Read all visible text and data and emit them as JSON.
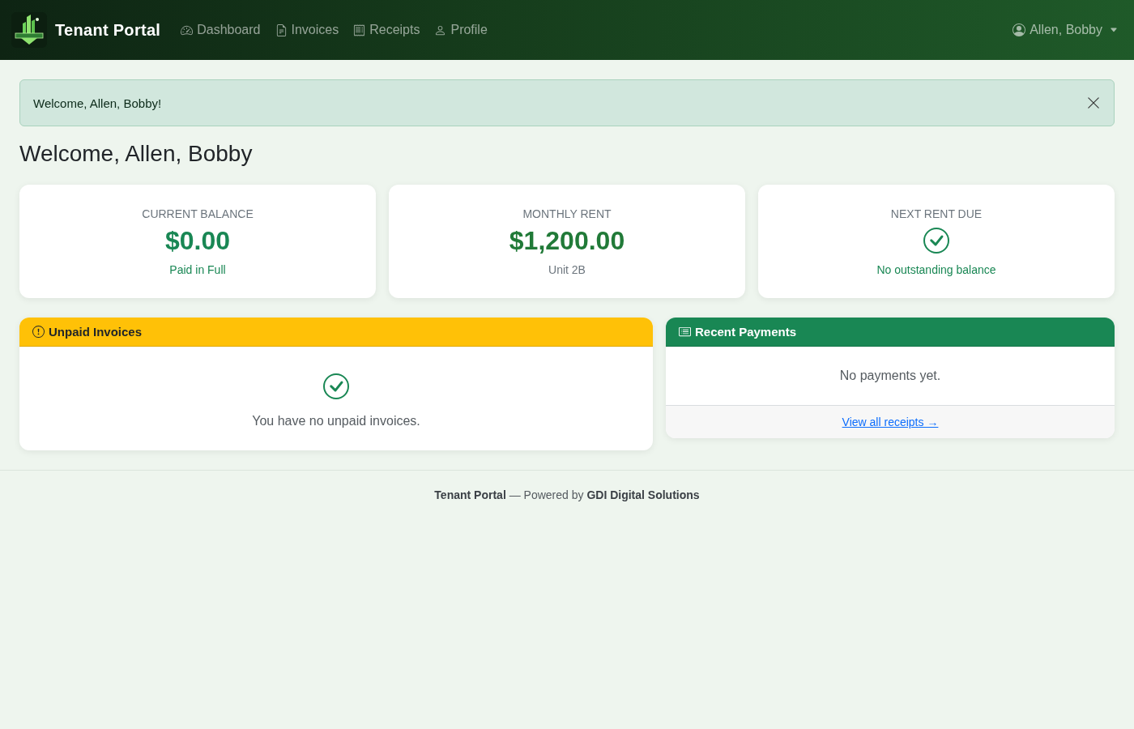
{
  "navbar": {
    "brand": "Tenant Portal",
    "links": [
      {
        "label": "Dashboard",
        "selected": false
      },
      {
        "label": "Invoices",
        "selected": false
      },
      {
        "label": "Receipts",
        "selected": false
      },
      {
        "label": "Profile",
        "selected": false
      }
    ],
    "user": {
      "name": "Allen, Bobby"
    }
  },
  "alert": {
    "message": "Welcome, Allen, Bobby!"
  },
  "heading": "Welcome, Allen, Bobby",
  "stat_cards": [
    {
      "kind": "amount",
      "label": "CURRENT BALANCE",
      "value": "$0.00",
      "note": "Paid in Full"
    },
    {
      "kind": "amount",
      "label": "MONTHLY RENT",
      "value": "$1,200.00",
      "note": "Unit 2B"
    },
    {
      "kind": "check",
      "label": "NEXT RENT DUE",
      "note": "No outstanding balance"
    }
  ],
  "panels": [
    {
      "kind": "check",
      "color": "#ffc107",
      "title": "Unpaid Invoices",
      "message": "You have no unpaid invoices."
    },
    {
      "kind": "plain",
      "color": "#198754",
      "title": "Recent Payments",
      "message": "No payments yet.",
      "footer_link": "View all receipts →"
    }
  ],
  "footer": {
    "text": "**Tenant Portal** — Powered by **GDI Digital Solutions**"
  }
}
